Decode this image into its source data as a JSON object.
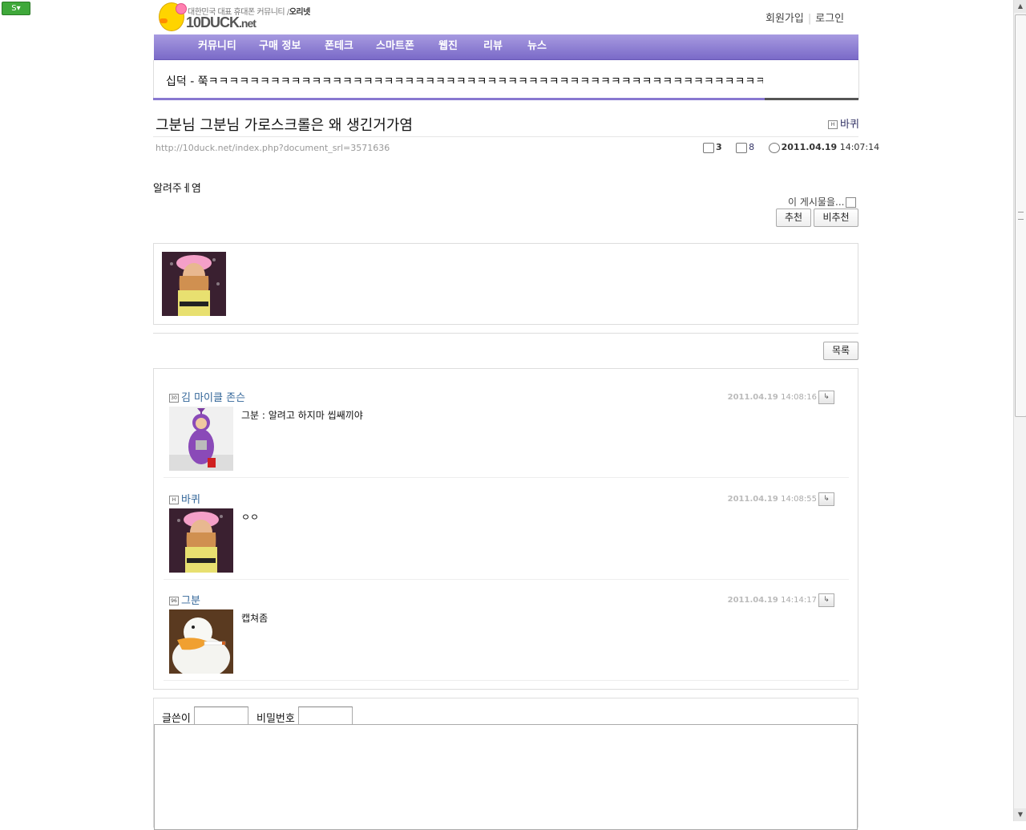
{
  "browser": {
    "addon_label": "S"
  },
  "header": {
    "logo_tagline": "대한민국 대표 휴대폰 커뮤니티 /",
    "logo_tagline_bold": "오리넷",
    "logo_name": "10DUCK",
    "logo_suffix": ".net",
    "signup": "회원가입",
    "separator": "|",
    "login": "로그인"
  },
  "nav": {
    "items": [
      "커뮤니티",
      "구매 정보",
      "폰테크",
      "스마트폰",
      "웹진",
      "리뷰",
      "뉴스"
    ]
  },
  "ticker": {
    "text": "십덕 - 쭉ㅋㅋㅋㅋㅋㅋㅋㅋㅋㅋㅋㅋㅋㅋㅋㅋㅋㅋㅋㅋㅋㅋㅋㅋㅋㅋㅋㅋㅋㅋㅋㅋㅋㅋㅋㅋㅋㅋㅋㅋㅋㅋㅋㅋㅋㅋㅋㅋㅋㅋㅋㅋㅋㅋ"
  },
  "post": {
    "title": "그분님 그분님 가로스크롤은 왜 생긴거가염",
    "author": "바퀴",
    "author_level": "H",
    "url": "http://10duck.net/index.php?document_srl=3571636",
    "comment_count": "3",
    "view_count": "8",
    "date": "2011.04.19",
    "time": "14:07:14",
    "body": "알려주ㅔ염",
    "menu_label": "이 게시물을...",
    "recommend": "추천",
    "not_recommend": "비추천",
    "list_button": "목록"
  },
  "comments": [
    {
      "author": "김 마이클 존슨",
      "level": "30",
      "date": "2011.04.19",
      "time": "14:08:16",
      "text": "그분 : 알려고 하지마 씹쌔끼야",
      "avatar": "teletubby"
    },
    {
      "author": "바퀴",
      "level": "H",
      "date": "2011.04.19",
      "time": "14:08:55",
      "text": "ㅇㅇ",
      "avatar": "dancer"
    },
    {
      "author": "그분",
      "level": "96",
      "date": "2011.04.19",
      "time": "14:14:17",
      "text": "캡쳐좀",
      "avatar": "duck"
    }
  ],
  "write": {
    "author_label": "글쓴이",
    "password_label": "비밀번호"
  },
  "colors": {
    "nav": "#8a7ad0",
    "accent": "#8878d0",
    "comment_author": "#336699"
  }
}
